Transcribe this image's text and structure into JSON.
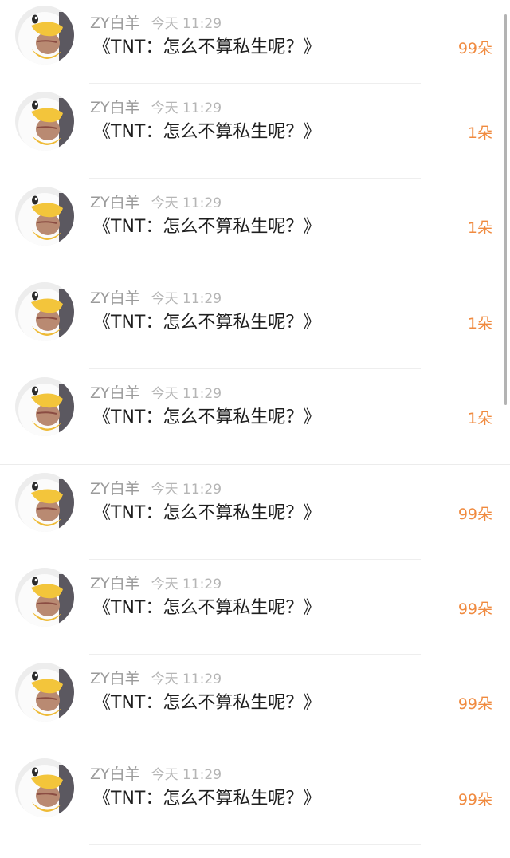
{
  "items": [
    {
      "name": "ZY白羊",
      "time": "今天 11:29",
      "title": "《TNT：怎么不算私生呢？》",
      "flowers": "99朵"
    },
    {
      "name": "ZY白羊",
      "time": "今天 11:29",
      "title": "《TNT：怎么不算私生呢？》",
      "flowers": "1朵"
    },
    {
      "name": "ZY白羊",
      "time": "今天 11:29",
      "title": "《TNT：怎么不算私生呢？》",
      "flowers": "1朵"
    },
    {
      "name": "ZY白羊",
      "time": "今天 11:29",
      "title": "《TNT：怎么不算私生呢？》",
      "flowers": "1朵"
    },
    {
      "name": "ZY白羊",
      "time": "今天 11:29",
      "title": "《TNT：怎么不算私生呢？》",
      "flowers": "1朵"
    },
    {
      "name": "ZY白羊",
      "time": "今天 11:29",
      "title": "《TNT：怎么不算私生呢？》",
      "flowers": "99朵"
    },
    {
      "name": "ZY白羊",
      "time": "今天 11:29",
      "title": "《TNT：怎么不算私生呢？》",
      "flowers": "99朵"
    },
    {
      "name": "ZY白羊",
      "time": "今天 11:29",
      "title": "《TNT：怎么不算私生呢？》",
      "flowers": "99朵"
    },
    {
      "name": "ZY白羊",
      "time": "今天 11:29",
      "title": "《TNT：怎么不算私生呢？》",
      "flowers": "99朵"
    }
  ],
  "colors": {
    "flowers": "#f08a3f",
    "name": "#9a9a9a",
    "time": "#b5b5b5",
    "title": "#1f1f1f"
  },
  "icons": {
    "avatar": "duck-costume-avatar-icon"
  }
}
